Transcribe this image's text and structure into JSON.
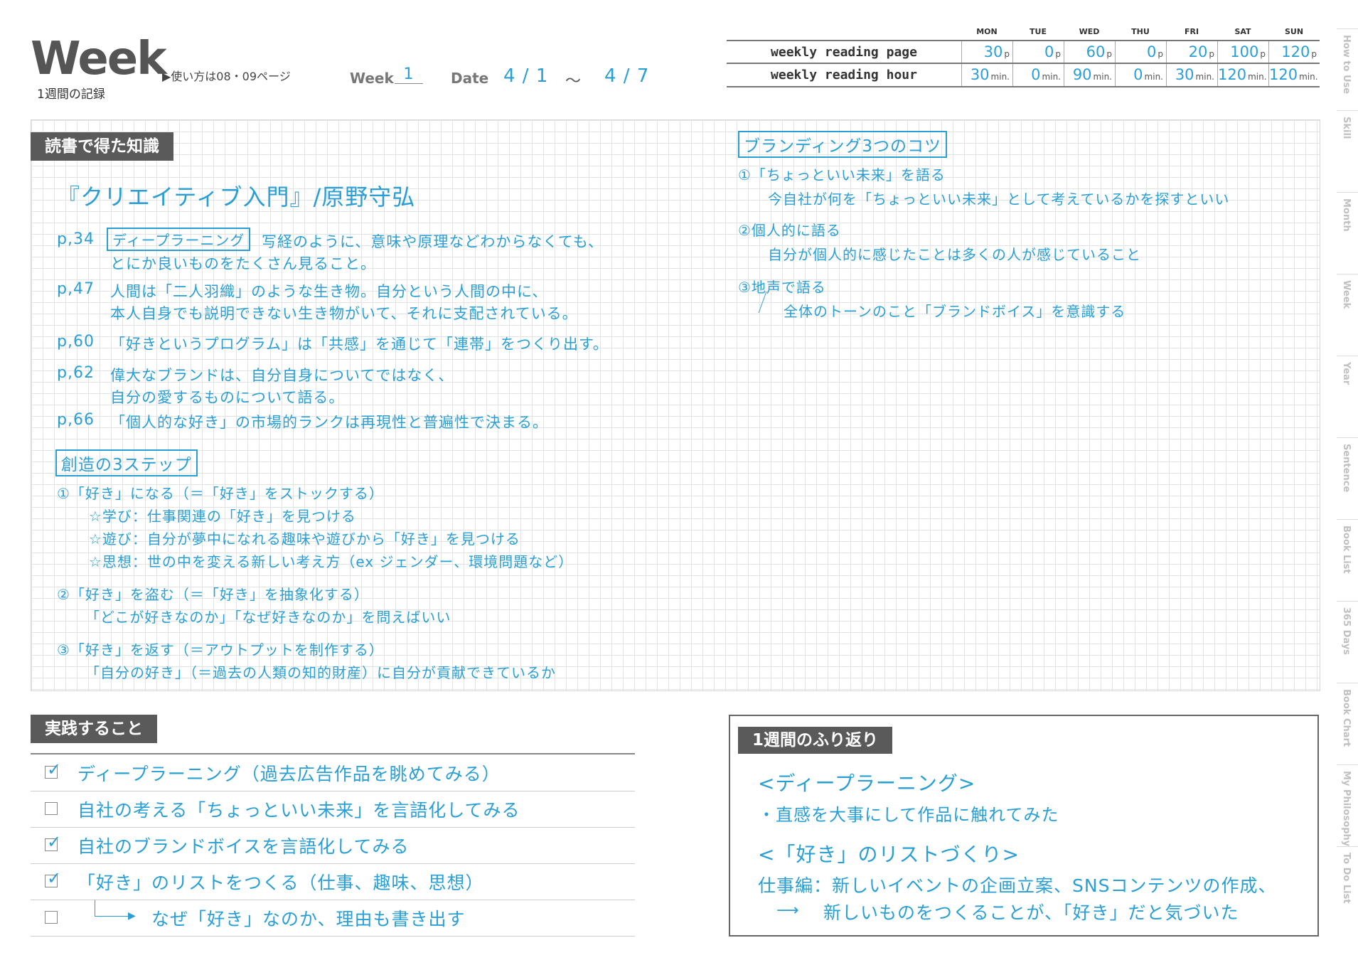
{
  "header": {
    "title": "Week",
    "subtitle": "1週間の記録",
    "howto": "▶使い方は08・09ページ",
    "week_label": "Week",
    "week_value": "1",
    "date_label": "Date",
    "date_from": "4 / 1",
    "date_sep": "～",
    "date_to": "4 / 7"
  },
  "reading_table": {
    "days": [
      "MON",
      "TUE",
      "WED",
      "THU",
      "FRI",
      "SAT",
      "SUN"
    ],
    "rows": [
      {
        "label": "weekly reading page",
        "unit": "p",
        "values": [
          "30",
          "0",
          "60",
          "0",
          "20",
          "100",
          "120"
        ]
      },
      {
        "label": "weekly reading hour",
        "unit": "min.",
        "values": [
          "30",
          "0",
          "90",
          "0",
          "30",
          "120",
          "120"
        ]
      }
    ]
  },
  "knowledge": {
    "label": "読書で得た知識",
    "book_title": "『クリエイティブ入門』/原野守弘",
    "entries": [
      {
        "page": "p,34",
        "keyword": "ディープラーニング",
        "line1": "写経のように、意味や原理などわからなくても、",
        "line2": "とにか良いものをたくさん見ること。"
      },
      {
        "page": "p,47",
        "line1": "人間は「二人羽織」のような生き物。自分という人間の中に、",
        "line2": "本人自身でも説明できない生き物がいて、それに支配されている。"
      },
      {
        "page": "p,60",
        "line1": "「好きというプログラム」は「共感」を通じて「連帯」をつくり出す。"
      },
      {
        "page": "p,62",
        "line1": "偉大なブランドは、自分自身についてではなく、",
        "line2": "自分の愛するものについて語る。"
      },
      {
        "page": "p,66",
        "line1": "「個人的な好き」の市場的ランクは再現性と普遍性で決まる。"
      }
    ],
    "steps_heading": "創造の3ステップ",
    "steps": [
      "①「好き」になる（＝「好き」をストックする）",
      "☆学び：仕事関連の「好き」を見つける",
      "☆遊び：自分が夢中になれる趣味や遊びから「好き」を見つける",
      "☆思想：世の中を変える新しい考え方（ex ジェンダー、環境問題など）",
      "②「好き」を盗む（＝「好き」を抽象化する）",
      "「どこが好きなのか」「なぜ好きなのか」を問えばいい",
      "③「好き」を返す（＝アウトプットを制作する）",
      "「自分の好き」（＝過去の人類の知的財産）に自分が貢献できているか"
    ],
    "branding_heading": "ブランディング3つのコツ",
    "branding": [
      "①「ちょっといい未来」を語る",
      "今自社が何を「ちょっといい未来」として考えているかを探すといい",
      "②個人的に語る",
      "自分が個人的に感じたことは多くの人が感じていること",
      "③地声で語る",
      "全体のトーンのこと「ブランドボイス」を意識する"
    ]
  },
  "practice": {
    "label": "実践すること",
    "items": [
      {
        "text": "ディープラーニング（過去広告作品を眺めてみる）",
        "checked": "✓"
      },
      {
        "text": "自社の考える「ちょっといい未来」を言語化してみる",
        "checked": ""
      },
      {
        "text": "自社のブランドボイスを言語化してみる",
        "checked": "✓"
      },
      {
        "text": "「好き」のリストをつくる（仕事、趣味、思想）",
        "checked": "✓"
      },
      {
        "text": "なぜ「好き」なのか、理由も書き出す",
        "checked": ""
      }
    ]
  },
  "reflection": {
    "label": "1週間のふり返り",
    "h1": "<ディープラーニング>",
    "l1": "・直感を大事にして作品に触れてみた",
    "h2": "<「好き」のリストづくり>",
    "l2": "仕事編：新しいイベントの企画立案、SNSコンテンツの作成、",
    "l3": "新しいものをつくることが、「好き」だと気づいた"
  },
  "side_tabs": [
    "How to Use",
    "Skill",
    "Month",
    "Week",
    "Year",
    "Sentence",
    "Book List",
    "365 Days",
    "Book Chart",
    "My Philosophy",
    "To Do List"
  ]
}
